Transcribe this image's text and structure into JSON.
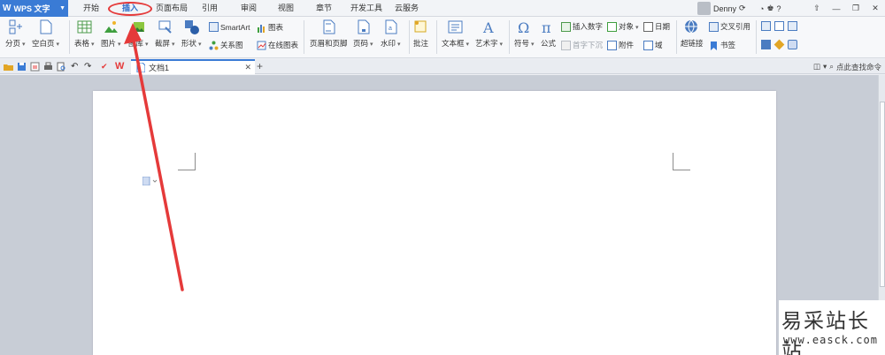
{
  "app": {
    "name": "WPS 文字"
  },
  "menu": {
    "tabs": [
      {
        "label": "开始"
      },
      {
        "label": "插入"
      },
      {
        "label": "页面布局"
      },
      {
        "label": "引用"
      },
      {
        "label": "审阅"
      },
      {
        "label": "视图"
      },
      {
        "label": "章节"
      },
      {
        "label": "开发工具"
      },
      {
        "label": "云服务"
      }
    ],
    "active_tab": "插入"
  },
  "user": {
    "name": "Denny"
  },
  "window_controls": {
    "help": "?"
  },
  "ribbon": {
    "page_break": "分页",
    "blank_page": "空白页",
    "table": "表格",
    "picture": "图片",
    "gallery": "图库",
    "screenshot": "截屏",
    "shapes": "形状",
    "smartart": "SmartArt",
    "chart": "图表",
    "relation_chart": "关系图",
    "online_chart": "在线图表",
    "header_footer": "页眉和页脚",
    "page_number": "页码",
    "watermark": "水印",
    "comment": "批注",
    "text_box": "文本框",
    "word_art": "艺术字",
    "symbol": "符号",
    "formula": "公式",
    "insert_number": "插入数字",
    "object": "对象",
    "date": "日期",
    "drop_cap": "首字下沉",
    "attachment": "附件",
    "field": "域",
    "hyperlink": "超链接",
    "cross_reference": "交叉引用",
    "bookmark": "书签"
  },
  "document": {
    "tab_title": "文档1",
    "close": "✕",
    "add": "+"
  },
  "find_command": {
    "label": "点此查找命令"
  },
  "brand_watermark": {
    "chinese": "易采站长站",
    "url": "www.easck.com"
  },
  "colors": {
    "accent": "#3a7bd5",
    "annotation": "#e53a3a",
    "workspace": "#c8cdd6"
  }
}
